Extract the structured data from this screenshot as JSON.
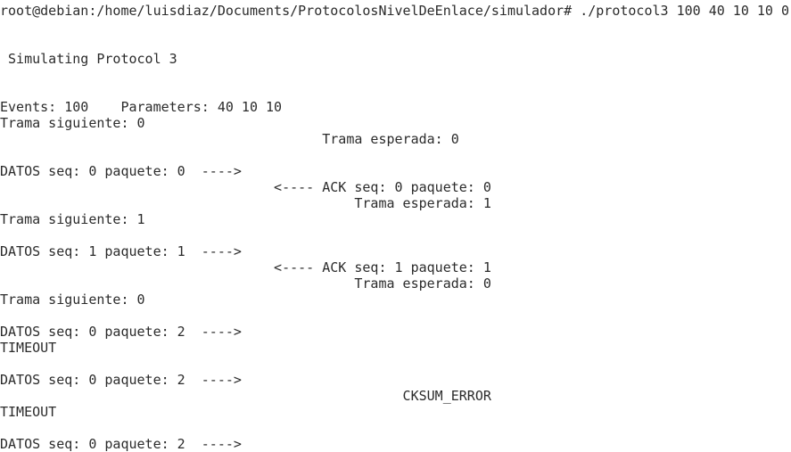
{
  "terminal": {
    "lines": [
      "root@debian:/home/luisdiaz/Documents/ProtocolosNivelDeEnlace/simulador# ./protocol3 100 40 10 10 0",
      "",
      "",
      " Simulating Protocol 3",
      "",
      "",
      "Events: 100    Parameters: 40 10 10",
      "Trama siguiente: 0",
      "                                        Trama esperada: 0",
      "",
      "DATOS seq: 0 paquete: 0  ---->",
      "                                  <---- ACK seq: 0 paquete: 0",
      "                                            Trama esperada: 1",
      "Trama siguiente: 1",
      "",
      "DATOS seq: 1 paquete: 1  ---->",
      "                                  <---- ACK seq: 1 paquete: 1",
      "                                            Trama esperada: 0",
      "Trama siguiente: 0",
      "",
      "DATOS seq: 0 paquete: 2  ---->",
      "TIMEOUT",
      "",
      "DATOS seq: 0 paquete: 2  ---->",
      "                                                  CKSUM_ERROR",
      "TIMEOUT",
      "",
      "DATOS seq: 0 paquete: 2  ---->"
    ]
  }
}
